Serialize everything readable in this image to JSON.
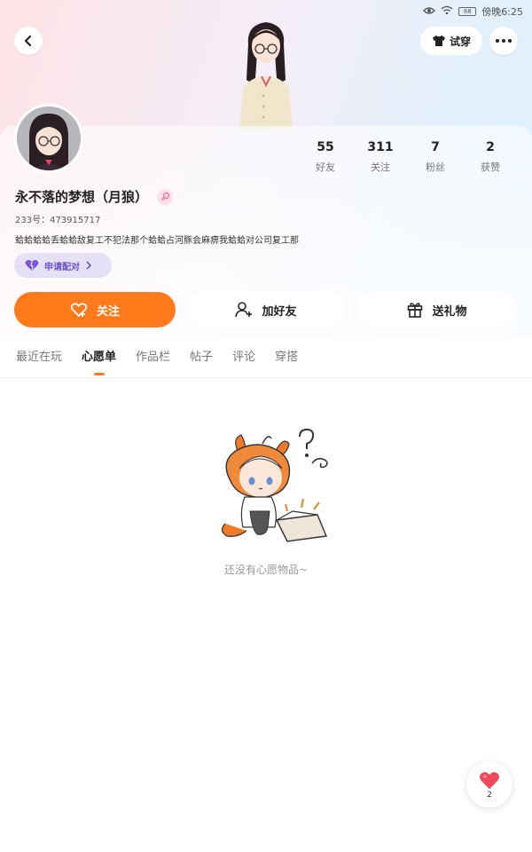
{
  "status_bar": {
    "time": "傍晚6:25",
    "battery": "68"
  },
  "header": {
    "try_on_label": "试穿"
  },
  "profile": {
    "nickname": "永不落的梦想（月狼）",
    "uid": "233号：473915717",
    "bio": "蛤蛤蛤蛤丢蛤蛤敌复工不犯法那个蛤蛤占河豚会麻痹我蛤蛤对公司复工那",
    "pair_label": "申请配对"
  },
  "stats": [
    {
      "value": "55",
      "label": "好友"
    },
    {
      "value": "311",
      "label": "关注"
    },
    {
      "value": "7",
      "label": "粉丝"
    },
    {
      "value": "2",
      "label": "获赞"
    }
  ],
  "actions": {
    "follow": "关注",
    "add_friend": "加好友",
    "gift": "送礼物"
  },
  "tabs": [
    {
      "label": "最近在玩"
    },
    {
      "label": "心愿单"
    },
    {
      "label": "作品栏"
    },
    {
      "label": "帖子"
    },
    {
      "label": "评论"
    },
    {
      "label": "穿搭"
    }
  ],
  "active_tab": "心愿单",
  "empty_state": {
    "text": "还没有心愿物品~"
  },
  "floating_like": {
    "count": "2"
  },
  "colors": {
    "accent": "#ff7a1b",
    "pair_bg": "#e6e0f7",
    "pair_text": "#6a50c8",
    "heart": "#f04a5a"
  }
}
